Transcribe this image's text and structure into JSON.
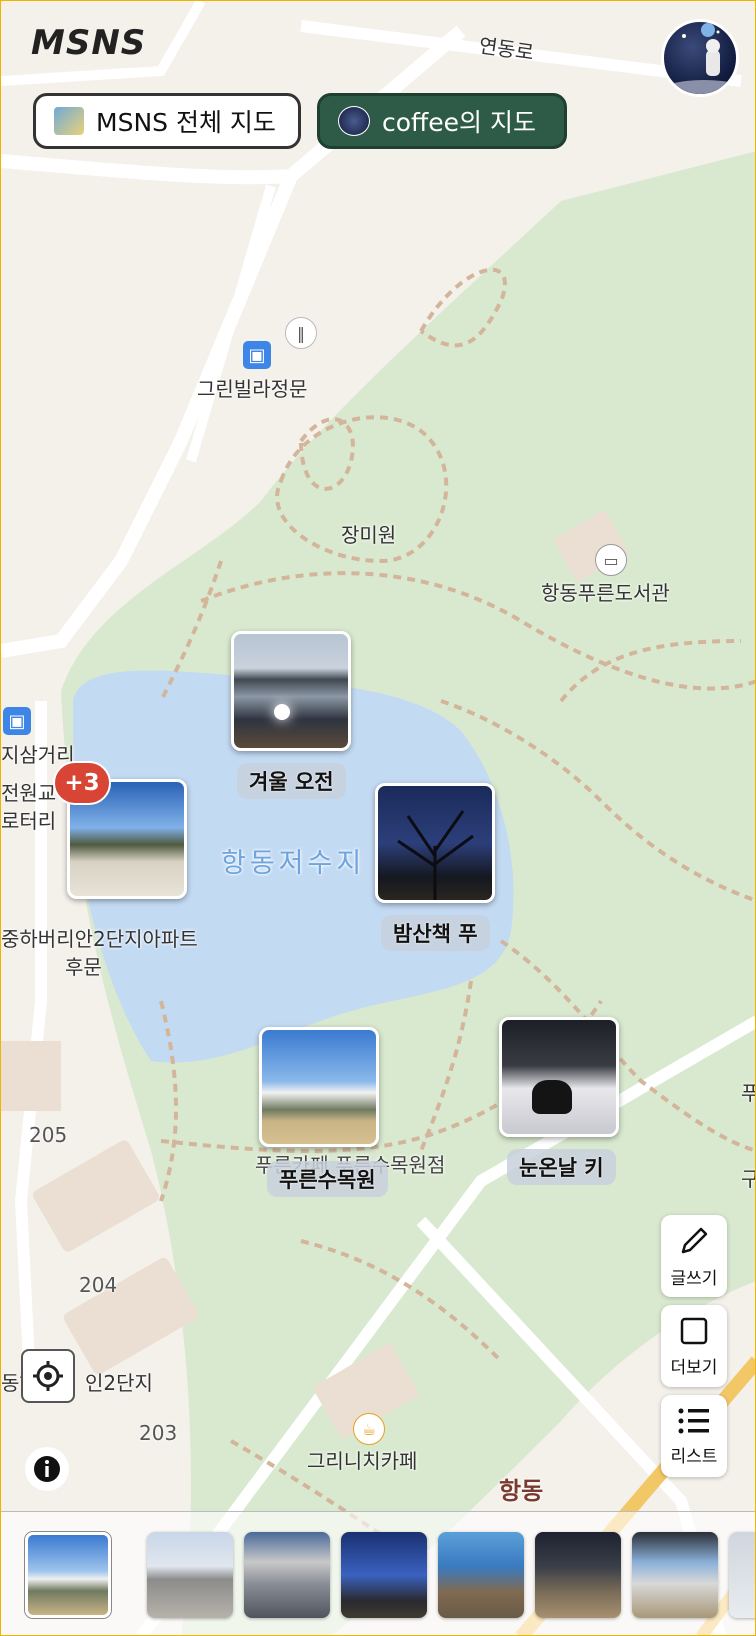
{
  "app": {
    "logo": "MSNS"
  },
  "header": {
    "all_map_label": "MSNS 전체 지도",
    "user_map_label": "coffee의 지도"
  },
  "map_labels": {
    "road_top": "연동로",
    "bus_stop_1": "그린빌라정문",
    "rose_garden": "장미원",
    "library": "항동푸른도서관",
    "junction": "지삼거리",
    "rotary_1": "전원교",
    "rotary_2": "로터리",
    "lake": "항동저수지",
    "apt_1": "중하버리안2단지아파트",
    "apt_1b": "후문",
    "num_205": "205",
    "num_204": "204",
    "num_203": "203",
    "apt_2": "동하",
    "apt_2b": "인2단지",
    "cafe_1": "푸른카페 푸른수목원점",
    "cafe_2": "그리니치카페",
    "district": "항동",
    "edge_1": "푸",
    "edge_2": "구"
  },
  "posts": [
    {
      "tag": "겨울 오전"
    },
    {
      "tag": "밤산책 푸"
    },
    {
      "tag": "푸른수목원"
    },
    {
      "tag": "눈온날 키"
    },
    {
      "tag": ""
    }
  ],
  "cluster_badge": "+3",
  "side_buttons": {
    "write": "글쓰기",
    "more": "더보기",
    "list": "리스트"
  },
  "icons": {
    "write": "pencil-icon",
    "more": "square-icon",
    "list": "list-icon",
    "locate": "crosshair-icon",
    "info": "info-icon"
  },
  "colors": {
    "map_bg": "#f4f0ea",
    "park": "#d9e9cf",
    "water": "#c3daf3",
    "accent": "#2e5b47",
    "badge": "#d84535"
  },
  "strip_count": 8
}
